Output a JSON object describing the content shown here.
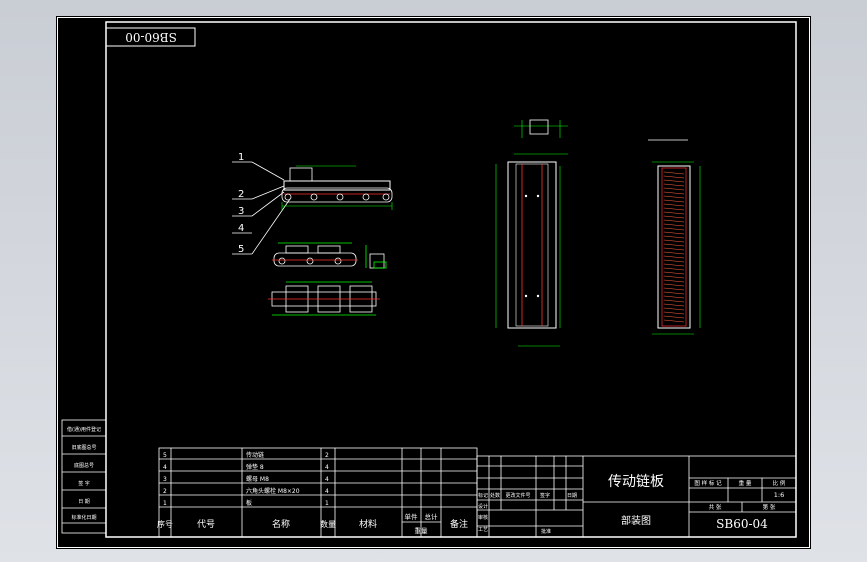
{
  "drawing": {
    "rotated_code": "SB60-00",
    "callouts": [
      "1",
      "2",
      "3",
      "4",
      "5"
    ]
  },
  "side_labels": [
    "借(通)用件登记",
    "旧底图总号",
    "底图总号",
    "签  字",
    "日  期",
    "标准化日期"
  ],
  "bom": {
    "headers": {
      "seq": "序号",
      "code": "代号",
      "name": "名称",
      "qty": "数量",
      "material": "材料",
      "unit": "单件",
      "total": "总计",
      "weight": "重量",
      "remark": "备注"
    },
    "rows": [
      {
        "seq": "5",
        "name": "传动链",
        "qty": "2"
      },
      {
        "seq": "4",
        "name": "弹垫 8",
        "qty": "4"
      },
      {
        "seq": "3",
        "name": "螺母 M8",
        "qty": "4"
      },
      {
        "seq": "2",
        "name": "六角头螺栓 M8×20",
        "qty": "4"
      },
      {
        "seq": "1",
        "name": "板",
        "qty": "1"
      }
    ]
  },
  "title_block": {
    "title": "传动链板",
    "drawing_type": "部装图",
    "number": "SB60-04",
    "scale": "1:6",
    "stage_header": "图 样 标 记",
    "weight_header": "重 量",
    "scale_header": "比 例",
    "sheet_total": "共   张",
    "sheet_no": "第   张",
    "revision_labels": [
      "标记",
      "处数",
      "更改文件号",
      "签字",
      "日期"
    ],
    "sign_labels": [
      "设计",
      "审核",
      "工艺",
      "批准"
    ]
  },
  "colors": {
    "background": "#000000",
    "line": "#ffffff",
    "dimension": "#00ff00",
    "center": "#ff3030",
    "frame": "#2a2f3a"
  }
}
